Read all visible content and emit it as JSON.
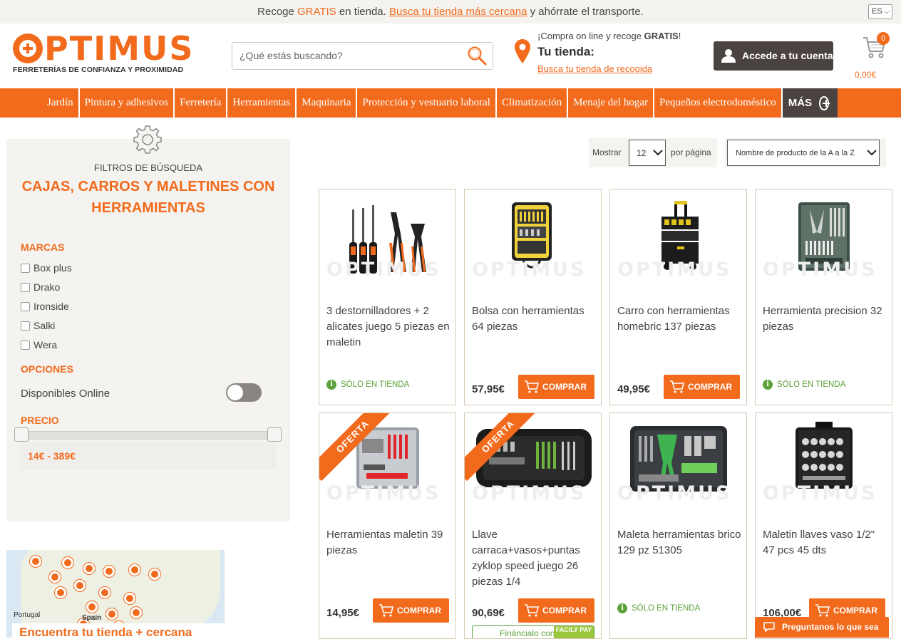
{
  "topbar": {
    "part1": "Recoge ",
    "gratis": "GRATIS",
    "part2": " en tienda. ",
    "link": "Busca tu tienda más cercana",
    "part3": " y ahórrate el transporte.",
    "lang": "ES"
  },
  "logo": {
    "name": "OPTIMUS",
    "tagline": "FERRETERÍAS DE CONFIANZA Y PROXIMIDAD"
  },
  "search": {
    "placeholder": "¿Qué estás buscando?"
  },
  "store": {
    "line1_prefix": "¡Compra on line y recoge ",
    "line1_bold": "GRATIS",
    "line1_suffix": "!",
    "title": "Tu tienda:",
    "link": "Busca tu tienda de recogida"
  },
  "account": {
    "label": "Accede a tu cuenta"
  },
  "cart": {
    "count": "0",
    "total": "0,00€"
  },
  "nav": {
    "items": [
      "Jardín",
      "Pintura y adhesivos",
      "Ferretería",
      "Herramientas",
      "Maquinaria",
      "Protección y vestuario laboral",
      "Climatización",
      "Menaje del hogar",
      "Pequeños electrodoméstico"
    ],
    "more": "MÁS"
  },
  "filters": {
    "heading": "FILTROS DE BÚSQUEDA",
    "title": "CAJAS, CARROS Y MALETINES CON HERRAMIENTAS",
    "brands_title": "MARCAS",
    "brands": [
      "Box plus",
      "Drako",
      "Ironside",
      "Salki",
      "Wera"
    ],
    "options_title": "OPCIONES",
    "online_label": "Disponibles Online",
    "price_title": "PRECIO",
    "price_range": "14€ - 389€"
  },
  "map": {
    "labels": [
      "Portugal",
      "Spain"
    ],
    "caption": "Encuentra tu tienda + cercana"
  },
  "toolbar": {
    "show_label": "Mostrar",
    "per_page_value": "12",
    "per_page_label": "por página",
    "sort_value": "Nombre de producto de la A a la Z"
  },
  "products": [
    {
      "name": "3 destornilladores + 2 alicates juego 5 piezas en maletin",
      "price": "",
      "action": "",
      "badge": "SÓLO EN TIENDA",
      "oferta": ""
    },
    {
      "name": "Bolsa con herramientas 64 piezas",
      "price": "57,95€",
      "action": "COMPRAR",
      "badge": "",
      "oferta": ""
    },
    {
      "name": "Carro con herramientas homebric 137 piezas",
      "price": "49,95€",
      "action": "COMPRAR",
      "badge": "",
      "oferta": ""
    },
    {
      "name": "Herramienta precision 32 piezas",
      "price": "",
      "action": "",
      "badge": "SÓLO EN TIENDA",
      "oferta": ""
    },
    {
      "name": "Herramientas maletin 39 piezas",
      "price": "14,95€",
      "action": "COMPRAR",
      "badge": "",
      "oferta": "OFERTA"
    },
    {
      "name": "Llave carraca+vasos+puntas zyklop speed juego 26 piezas 1/4",
      "price": "90,69€",
      "action": "COMPRAR",
      "badge": "",
      "oferta": "OFERTA",
      "finance": "Fináncialo con",
      "finance_tag": "FACILY PAY"
    },
    {
      "name": "Maleta herramientas brico 129 pz 51305",
      "price": "",
      "action": "",
      "badge": "SÓLO EN TIENDA",
      "oferta": ""
    },
    {
      "name": "Maletin llaves vaso 1/2\" 47 pcs 45 dts",
      "price": "106,00€",
      "action": "COMPRAR",
      "badge": "",
      "oferta": ""
    }
  ],
  "watermark": "OPTIMUS",
  "chat": {
    "label": "Preguntanos lo que sea"
  },
  "colors": {
    "brand": "#f26b1d",
    "dark": "#4a4340",
    "panel": "#f4f3ef",
    "green": "#5aa13a"
  }
}
